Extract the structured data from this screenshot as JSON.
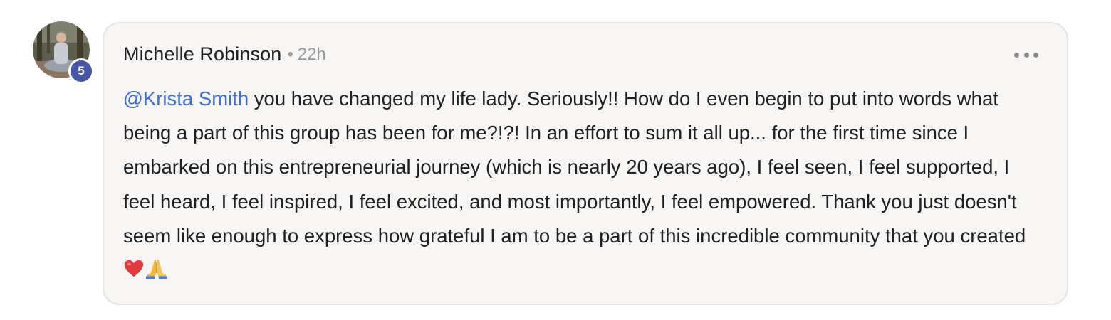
{
  "comment": {
    "author": "Michelle Robinson",
    "separator": "•",
    "time": "22h",
    "level": "5",
    "mention": "@Krista Smith",
    "text": " you have changed my life lady. Seriously!! How do I even begin to put into words what being a part of this group has been for me?!?! In an effort to sum it all up... for the first time since I embarked on this entrepreneurial journey (which is nearly 20 years ago), I feel seen, I feel supported, I feel heard, I feel inspired, I feel excited, and most importantly, I feel empowered. Thank you just doesn't seem like enough to express how grateful I am to be a part of this incredible community that you created ",
    "emojis": [
      "heart-emoji",
      "praying-hands-emoji"
    ],
    "menu_icon": "more-horizontal-icon"
  },
  "colors": {
    "bubble_bg": "#f7f6f5",
    "bubble_border": "#e5e4e2",
    "mention": "#3d6fd8",
    "badge": "#4655a6",
    "text": "#202020",
    "muted": "#9a9a9a"
  }
}
